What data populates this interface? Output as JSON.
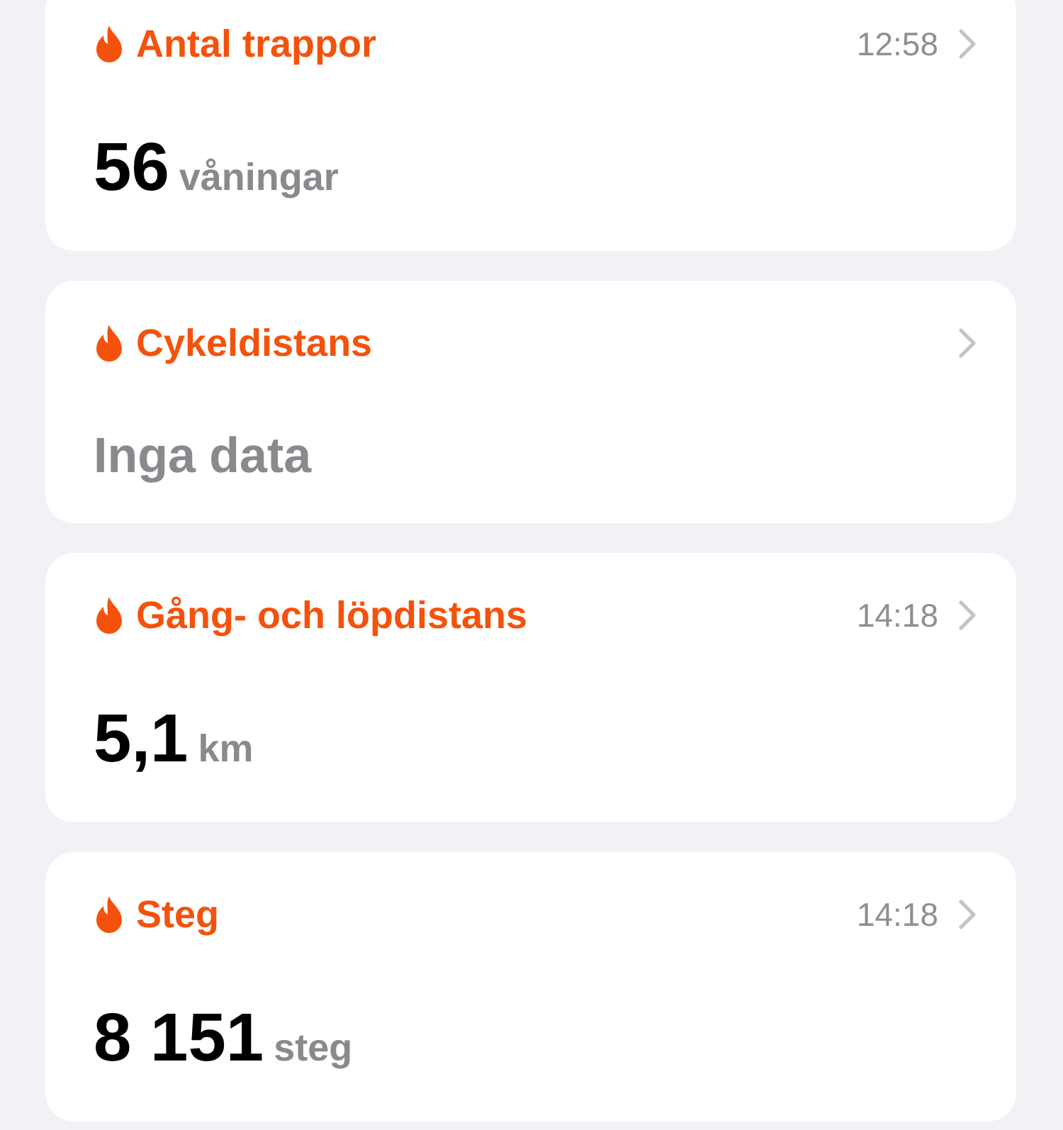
{
  "cards": [
    {
      "kind": "value",
      "title": "Antal trappor",
      "time": "12:58",
      "value": "56",
      "unit": "våningar"
    },
    {
      "kind": "empty",
      "title": "Cykeldistans",
      "message": "Inga data"
    },
    {
      "kind": "value",
      "title": "Gång- och löpdistans",
      "time": "14:18",
      "value": "5,1",
      "unit": "km"
    },
    {
      "kind": "value",
      "title": "Steg",
      "time": "14:18",
      "value": "8 151",
      "unit": "steg"
    }
  ]
}
